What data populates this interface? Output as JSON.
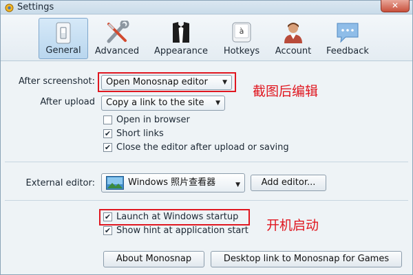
{
  "window": {
    "title": "Settings",
    "close_symbol": "✕"
  },
  "tabs": [
    {
      "label": "General",
      "icon": "light-switch-icon",
      "active": true
    },
    {
      "label": "Advanced",
      "icon": "wrench-screwdriver-icon",
      "active": false
    },
    {
      "label": "Appearance",
      "icon": "tuxedo-icon",
      "active": false
    },
    {
      "label": "Hotkeys",
      "icon": "keyboard-key-icon",
      "active": false
    },
    {
      "label": "Account",
      "icon": "user-avatar-icon",
      "active": false
    },
    {
      "label": "Feedback",
      "icon": "speech-bubble-icon",
      "active": false
    }
  ],
  "general": {
    "after_screenshot_label": "After screenshot:",
    "after_screenshot_value": "Open Monosnap editor",
    "after_upload_label": "After upload",
    "after_upload_value": "Copy a link to the site",
    "checks": [
      {
        "label": "Open in browser",
        "checked": false
      },
      {
        "label": "Short links",
        "checked": true
      },
      {
        "label": "Close the editor after upload or saving",
        "checked": true
      }
    ],
    "external_editor_label": "External editor:",
    "external_editor_value": "Windows 照片查看器",
    "add_editor_label": "Add editor...",
    "startup_checks": [
      {
        "label": "Launch at Windows startup",
        "checked": true
      },
      {
        "label": "Show hint at application start",
        "checked": true
      }
    ],
    "about_label": "About Monosnap",
    "desktop_link_label": "Desktop link to Monosnap for Games"
  },
  "annotations": {
    "screenshot_note": "截图后编辑",
    "startup_note": "开机启动",
    "color": "#e0161f"
  },
  "check_symbol": "✔",
  "dropdown_arrow": "▼"
}
